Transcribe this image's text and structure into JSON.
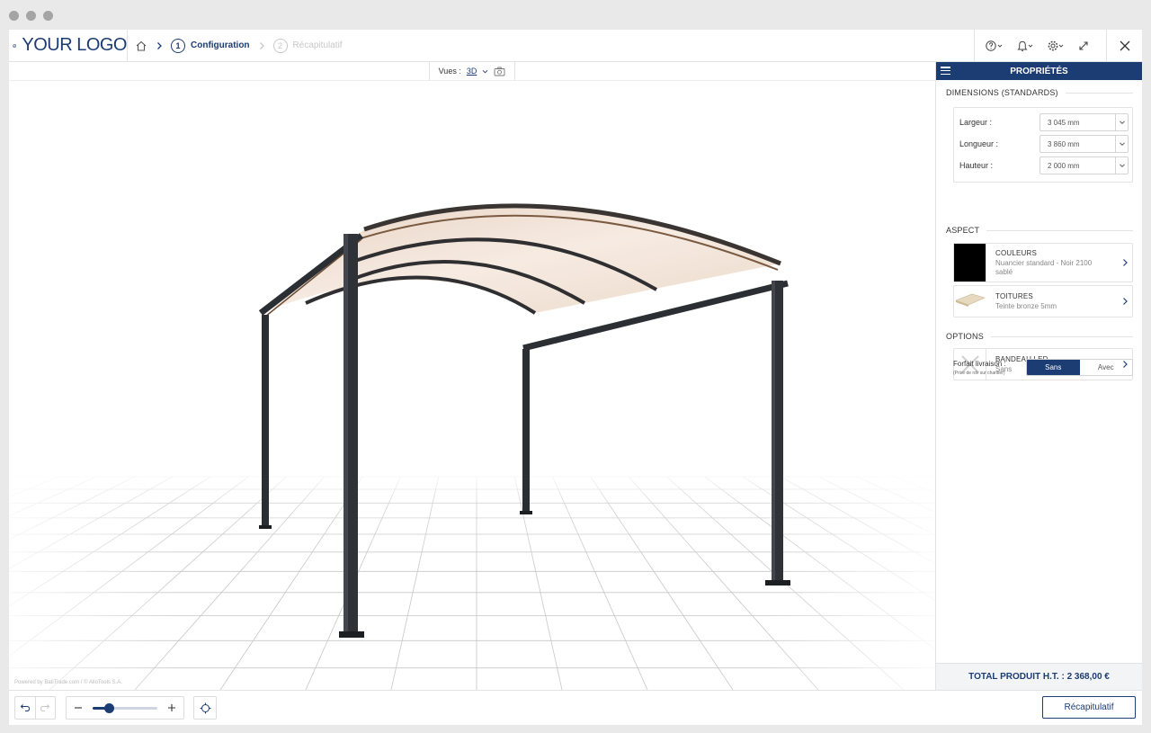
{
  "header": {
    "logo_text": "YOUR LOGO",
    "steps": [
      {
        "number": "1",
        "label": "Configuration"
      },
      {
        "number": "2",
        "label": "Récapitulatif"
      }
    ]
  },
  "viewport": {
    "views_label": "Vues :",
    "view_mode": "3D",
    "powered_by": "Powered by BatiTrade.com / © AlloTools S.A."
  },
  "panel": {
    "title": "PROPRIÉTÉS",
    "dimensions": {
      "title": "DIMENSIONS (STANDARDS)",
      "rows": [
        {
          "label": "Largeur :",
          "value": "3 045 mm"
        },
        {
          "label": "Longueur :",
          "value": "3 860 mm"
        },
        {
          "label": "Hauteur :",
          "value": "2 000 mm"
        }
      ]
    },
    "aspect": {
      "title": "ASPECT",
      "colors": {
        "title": "COULEURS",
        "value_line1": "Nuancier standard - Noir 2100",
        "value_line2": "sablé",
        "swatch": "#000000"
      },
      "roof": {
        "title": "TOITURES",
        "value": "Teinte bronze 5mm"
      }
    },
    "options": {
      "title": "OPTIONS",
      "led": {
        "title": "BANDEAU LED",
        "value": "Sans"
      },
      "delivery_label": "Forfait livraison :",
      "delivery_note": "(Prise de rdv sur chantier)",
      "delivery_choices": [
        "Sans",
        "Avec"
      ],
      "delivery_selected": "Sans"
    },
    "total": "TOTAL PRODUIT H.T. : 2 368,00 €"
  },
  "toolbar": {
    "zoom_level": 0.25,
    "recap_label": "Récapitulatif"
  },
  "colors": {
    "accent": "#1c3c74",
    "frame": "#2b2e33",
    "roof": "#efdfd4"
  }
}
